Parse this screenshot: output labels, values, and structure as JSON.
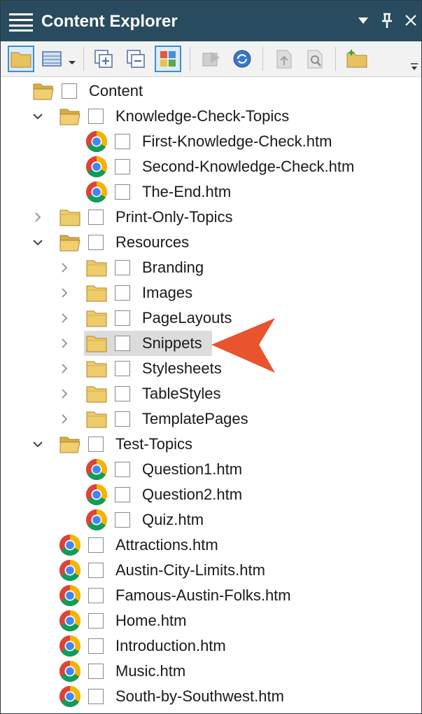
{
  "panel": {
    "title": "Content Explorer",
    "controls": {
      "dropdown": "▾",
      "pin": "📌",
      "close": "✕"
    }
  },
  "colors": {
    "titlebar": "#294b5f",
    "folder": "#e8c25f",
    "arrow": "#e9532e",
    "selection": "#dcdcdc"
  },
  "toolbar": {
    "buttons": [
      {
        "name": "open-folder-icon"
      },
      {
        "name": "grid-view-icon"
      },
      {
        "name": "expand-all-icon"
      },
      {
        "name": "collapse-all-icon"
      },
      {
        "name": "tiles-icon"
      },
      {
        "name": "send-icon"
      },
      {
        "name": "refresh-icon"
      },
      {
        "name": "upload-icon"
      },
      {
        "name": "properties-icon"
      },
      {
        "name": "new-folder-icon"
      }
    ]
  },
  "tree": {
    "items": [
      {
        "label": "Content",
        "type": "folder",
        "level": 0,
        "state": "none",
        "open": true
      },
      {
        "label": "Knowledge-Check-Topics",
        "type": "folder",
        "level": 1,
        "state": "expanded",
        "open": true
      },
      {
        "label": "First-Knowledge-Check.htm",
        "type": "file",
        "level": 2,
        "state": "none"
      },
      {
        "label": "Second-Knowledge-Check.htm",
        "type": "file",
        "level": 2,
        "state": "none"
      },
      {
        "label": "The-End.htm",
        "type": "file",
        "level": 2,
        "state": "none"
      },
      {
        "label": "Print-Only-Topics",
        "type": "folder",
        "level": 1,
        "state": "collapsed"
      },
      {
        "label": "Resources",
        "type": "folder",
        "level": 1,
        "state": "expanded",
        "open": true
      },
      {
        "label": "Branding",
        "type": "folder",
        "level": 2,
        "state": "collapsed"
      },
      {
        "label": "Images",
        "type": "folder",
        "level": 2,
        "state": "collapsed"
      },
      {
        "label": "PageLayouts",
        "type": "folder",
        "level": 2,
        "state": "collapsed"
      },
      {
        "label": "Snippets",
        "type": "folder",
        "level": 2,
        "state": "collapsed",
        "selected": true
      },
      {
        "label": "Stylesheets",
        "type": "folder",
        "level": 2,
        "state": "collapsed"
      },
      {
        "label": "TableStyles",
        "type": "folder",
        "level": 2,
        "state": "collapsed"
      },
      {
        "label": "TemplatePages",
        "type": "folder",
        "level": 2,
        "state": "collapsed"
      },
      {
        "label": "Test-Topics",
        "type": "folder",
        "level": 1,
        "state": "expanded",
        "open": true
      },
      {
        "label": "Question1.htm",
        "type": "file",
        "level": 2,
        "state": "none"
      },
      {
        "label": "Question2.htm",
        "type": "file",
        "level": 2,
        "state": "none"
      },
      {
        "label": "Quiz.htm",
        "type": "file",
        "level": 2,
        "state": "none"
      },
      {
        "label": "Attractions.htm",
        "type": "file",
        "level": 1,
        "state": "none"
      },
      {
        "label": "Austin-City-Limits.htm",
        "type": "file",
        "level": 1,
        "state": "none"
      },
      {
        "label": "Famous-Austin-Folks.htm",
        "type": "file",
        "level": 1,
        "state": "none"
      },
      {
        "label": "Home.htm",
        "type": "file",
        "level": 1,
        "state": "none"
      },
      {
        "label": "Introduction.htm",
        "type": "file",
        "level": 1,
        "state": "none"
      },
      {
        "label": "Music.htm",
        "type": "file",
        "level": 1,
        "state": "none"
      },
      {
        "label": "South-by-Southwest.htm",
        "type": "file",
        "level": 1,
        "state": "none"
      }
    ]
  }
}
